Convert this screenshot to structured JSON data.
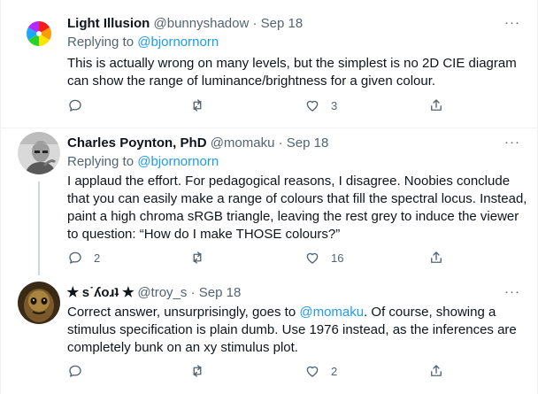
{
  "tweets": [
    {
      "name": "Light Illusion",
      "handle": "@bunnyshadow",
      "sep": "·",
      "date": "Sep 18",
      "replying_prefix": "Replying to ",
      "replying_to": "@bjornornorn",
      "text": "This is actually wrong on many levels, but the simplest is no 2D CIE diagram can show the range of luminance/brightness for a given colour.",
      "likes": "3"
    },
    {
      "name": "Charles Poynton, PhD",
      "handle": "@momaku",
      "sep": "·",
      "date": "Sep 18",
      "replying_prefix": "Replying to ",
      "replying_to": "@bjornornorn",
      "text": "I applaud the effort. For pedagogical reasons, I disagree. Noobies conclude that you can easily make a range of colours that fill the spectral locus. Instead, paint a high chroma sRGB triangle, leaving the rest grey to induce the viewer to question: “How do I make THOSE colours?”",
      "replies": "2",
      "likes": "16"
    },
    {
      "name": "✭ s˙ʎoɹʇ ✭",
      "handle": "@troy_s",
      "sep": "·",
      "date": "Sep 18",
      "text_before": "Correct answer, unsurprisingly, goes to ",
      "mention": "@momaku",
      "text_after": ". Of course, showing a stimulus specification is plain dumb. Use 1976 instead, as the inferences are completely bunk on an xy stimulus plot.",
      "likes": "2"
    }
  ],
  "more_glyph": "···",
  "icons": [
    "reply-icon",
    "retweet-icon",
    "like-icon",
    "share-icon",
    "more-icon"
  ],
  "colors": {
    "link": "#1d9bf0",
    "secondary": "#536471",
    "divider": "#eff3f4",
    "thread": "#cfd9de"
  }
}
